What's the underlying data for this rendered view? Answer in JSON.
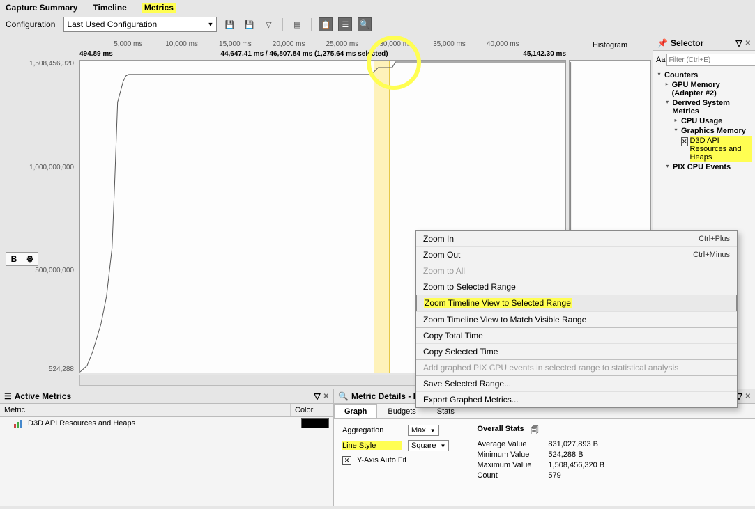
{
  "tabs": {
    "capture": "Capture Summary",
    "timeline": "Timeline",
    "metrics": "Metrics"
  },
  "config": {
    "label": "Configuration",
    "selected": "Last Used Configuration"
  },
  "axis": {
    "ticks": [
      "5,000 ms",
      "10,000 ms",
      "15,000 ms",
      "20,000 ms",
      "25,000 ms",
      "30,000 ms",
      "35,000 ms",
      "40,000 ms"
    ],
    "range_start": "494.89 ms",
    "range_mid": "44,647.41 ms / 46,807.84 ms (1,275.64 ms selected)",
    "range_end": "45,142.30 ms",
    "y_top": "1,508,456,320",
    "y_mid": "1,000,000,000",
    "y_low": "500,000,000",
    "y_bot": "524,288"
  },
  "histogram": {
    "title": "Histogram"
  },
  "side_btn": {
    "b": "B",
    "gear": "⚙"
  },
  "selector": {
    "title": "Selector",
    "filter_placeholder": "Filter (Ctrl+E)",
    "counters": "Counters",
    "gpu_mem": "GPU Memory (Adapter #2)",
    "derived": "Derived System Metrics",
    "cpu": "CPU Usage",
    "gfx": "Graphics Memory",
    "d3d": "D3D API Resources and Heaps",
    "pix": "PIX CPU Events"
  },
  "ctx": {
    "zoom_in": "Zoom In",
    "zoom_in_acc": "Ctrl+Plus",
    "zoom_out": "Zoom Out",
    "zoom_out_acc": "Ctrl+Minus",
    "zoom_all": "Zoom to All",
    "zoom_sel": "Zoom to Selected Range",
    "zoom_tl_sel": "Zoom Timeline View to Selected Range",
    "zoom_tl_match": "Zoom Timeline View to Match Visible Range",
    "copy_total": "Copy Total Time",
    "copy_sel": "Copy Selected Time",
    "add_stat": "Add graphed PIX CPU events in selected range to statistical analysis",
    "save_range": "Save Selected Range...",
    "export": "Export Graphed Metrics..."
  },
  "active": {
    "title": "Active Metrics",
    "col_metric": "Metric",
    "col_color": "Color",
    "row1": "D3D API Resources and Heaps"
  },
  "details": {
    "title": "Metric Details - D3D API Resources and Heaps",
    "tab_graph": "Graph",
    "tab_budgets": "Budgets",
    "tab_stats": "Stats",
    "agg": "Aggregation",
    "agg_val": "Max",
    "line": "Line Style",
    "line_val": "Square",
    "yauto": "Y-Axis Auto Fit",
    "overall": "Overall Stats",
    "avg_l": "Average Value",
    "avg_v": "831,027,893 B",
    "min_l": "Minimum Value",
    "min_v": "524,288 B",
    "max_l": "Maximum Value",
    "max_v": "1,508,456,320 B",
    "cnt_l": "Count",
    "cnt_v": "579"
  },
  "chart_data": {
    "type": "line",
    "title": "D3D API Resources and Heaps",
    "xlabel": "ms",
    "ylabel": "Bytes",
    "xlim": [
      494.89,
      45142.3
    ],
    "ylim": [
      524288,
      1508456320
    ],
    "x": [
      494,
      1200,
      1600,
      1800,
      2200,
      2600,
      3100,
      3300,
      3500,
      4100,
      4200,
      4300,
      27500,
      27600,
      27700,
      29300,
      29400,
      45142
    ],
    "y": [
      524288,
      20000000,
      60000000,
      120000000,
      190000000,
      320000000,
      560000000,
      900000000,
      1300000000,
      1430000000,
      1450000000,
      1460000000,
      1460000000,
      1480000000,
      1500000000,
      1500000000,
      1508456320,
      1508456320
    ],
    "selection_ms": [
      27500,
      28776
    ]
  }
}
